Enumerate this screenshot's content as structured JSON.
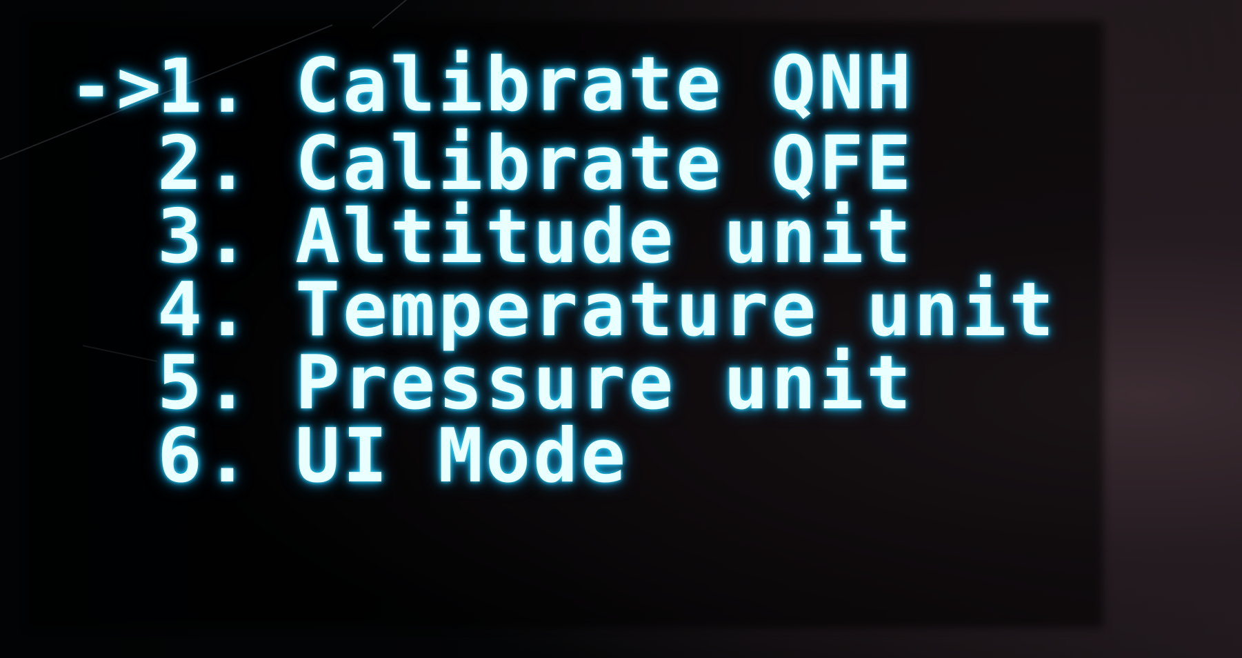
{
  "menu": {
    "cursor": "->",
    "selected_index": 0,
    "items": [
      {
        "number": "1.",
        "label": "Calibrate QNH"
      },
      {
        "number": "2.",
        "label": "Calibrate QFE"
      },
      {
        "number": "3.",
        "label": "Altitude unit"
      },
      {
        "number": "4.",
        "label": "Temperature unit"
      },
      {
        "number": "5.",
        "label": "Pressure unit"
      },
      {
        "number": "6.",
        "label": "UI Mode"
      }
    ]
  },
  "colors": {
    "text": "#eaffff",
    "glow": "#2fd9ff",
    "background": "#050506"
  }
}
